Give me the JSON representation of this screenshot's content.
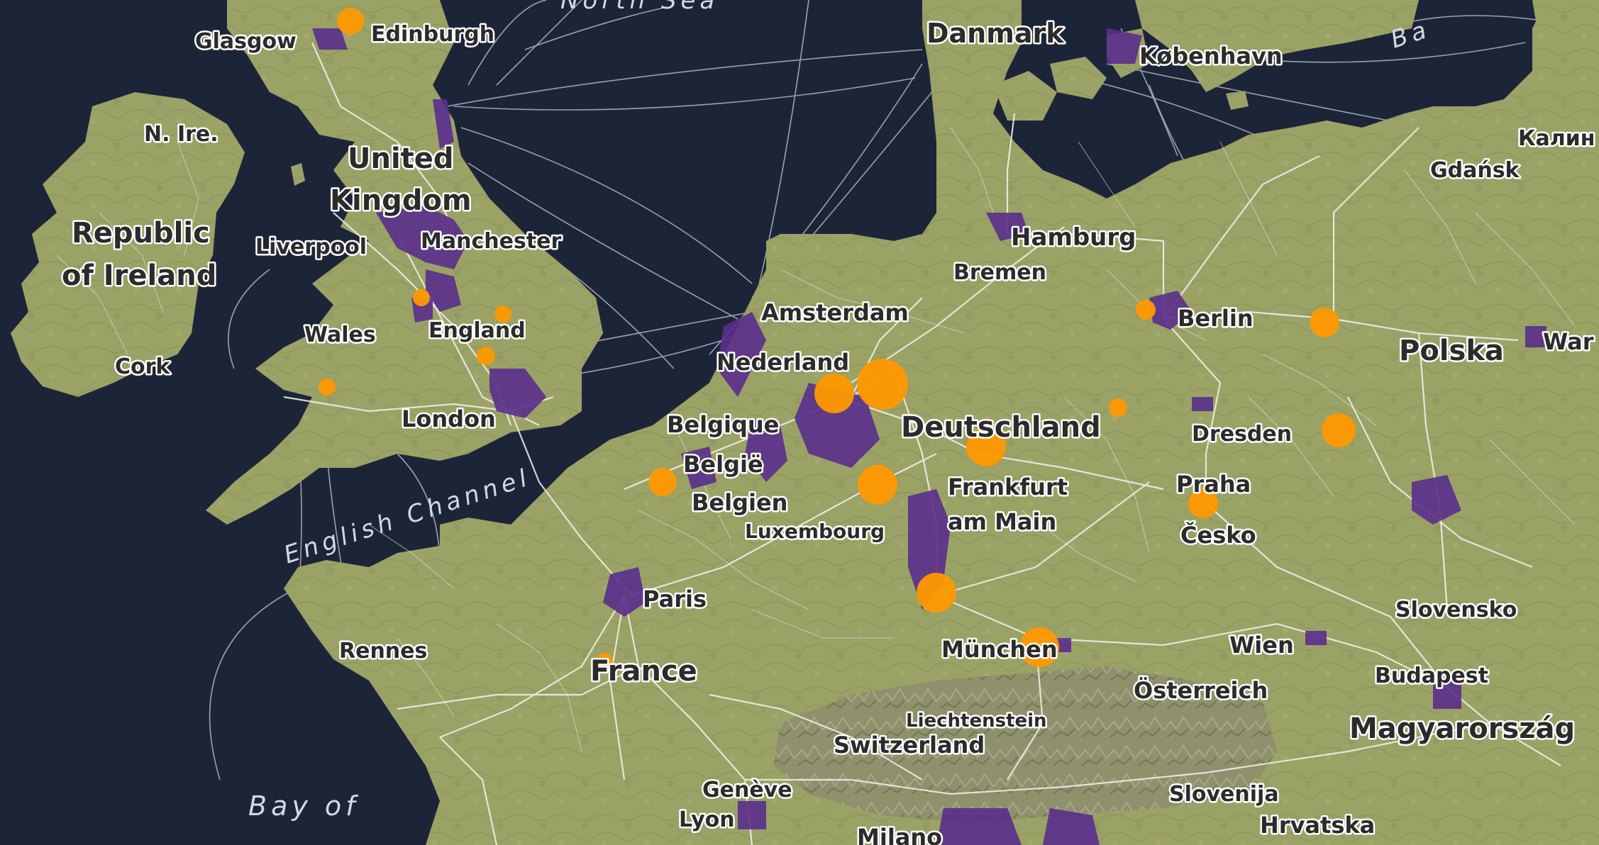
{
  "map": {
    "colors": {
      "water": "#1c2538",
      "land": "#9aa266",
      "land_dark": "#7e8a52",
      "mountains": "#8a8d6a",
      "roads": "#f2f2ee",
      "urban": "#5a2e8c",
      "marker": "#ff9800",
      "shipping_routes": "#c5cad6"
    },
    "water_labels": {
      "north_sea": "North Sea",
      "english_channel": "English Channel",
      "bay_of": "Bay of",
      "baltic": "Ba"
    },
    "countries": {
      "united_kingdom_line1": "United",
      "united_kingdom_line2": "Kingdom",
      "ireland_line1": "Republic",
      "ireland_line2": "of Ireland",
      "n_ireland": "N. Ire.",
      "wales": "Wales",
      "england": "England",
      "danmark": "Danmark",
      "nederland": "Nederland",
      "belgique": "Belgique",
      "belgie": "België",
      "belgien": "Belgien",
      "luxembourg": "Luxembourg",
      "deutschland": "Deutschland",
      "polska": "Polska",
      "cesko": "Česko",
      "slovensko": "Slovensko",
      "osterreich": "Österreich",
      "france": "France",
      "switzerland": "Switzerland",
      "liechtenstein": "Liechtenstein",
      "magyarorszag": "Magyarország",
      "slovenija": "Slovenija",
      "hrvatska": "Hrvatska"
    },
    "cities": {
      "glasgow": "Glasgow",
      "edinburgh": "Edinburgh",
      "liverpool": "Liverpool",
      "manchester": "Manchester",
      "london": "London",
      "cork": "Cork",
      "kobenhavn": "København",
      "kalin": "Калин",
      "gdansk": "Gdańsk",
      "hamburg": "Hamburg",
      "bremen": "Bremen",
      "amsterdam": "Amsterdam",
      "berlin": "Berlin",
      "war": "War",
      "dresden": "Dresden",
      "praha": "Praha",
      "frankfurt_line1": "Frankfurt",
      "frankfurt_line2": "am Main",
      "paris": "Paris",
      "rennes": "Rennes",
      "munchen": "München",
      "wien": "Wien",
      "budapest": "Budapest",
      "geneve": "Genève",
      "lyon": "Lyon",
      "milano": "Milano"
    }
  }
}
